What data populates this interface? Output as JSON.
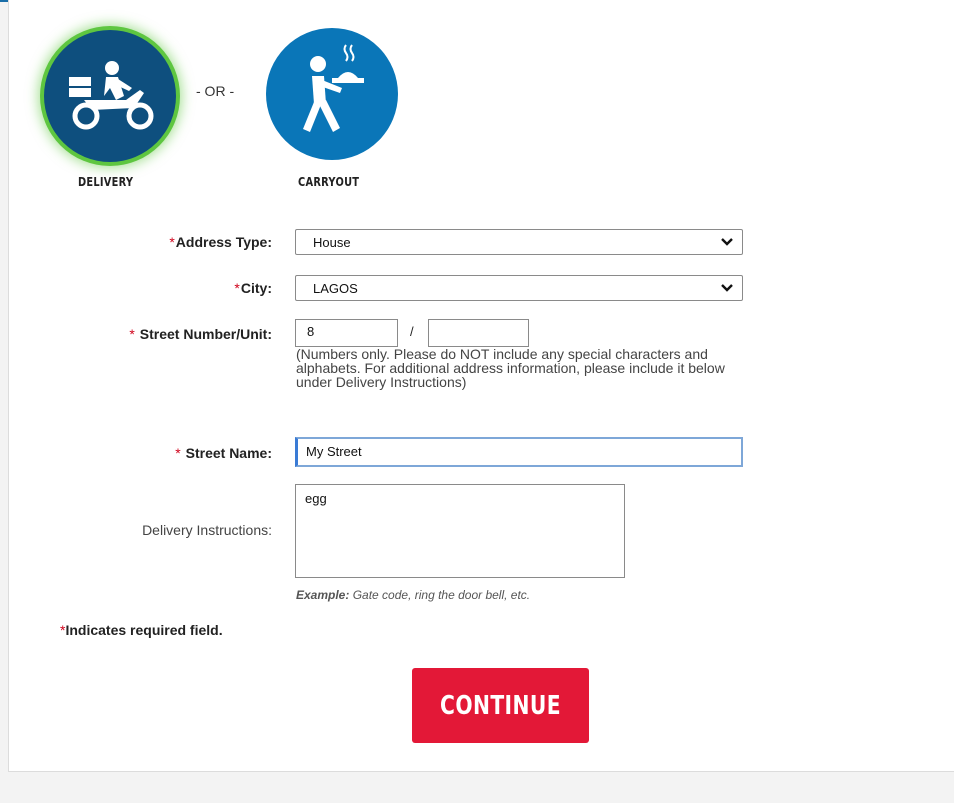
{
  "service_methods": {
    "separator": "- OR -",
    "delivery": {
      "label": "DELIVERY",
      "icon": "delivery-scooter-icon",
      "selected": true
    },
    "carryout": {
      "label": "CARRYOUT",
      "icon": "carryout-waiter-icon",
      "selected": false
    }
  },
  "form": {
    "required_marker": "*",
    "address_type": {
      "label": "Address Type:",
      "value": "House"
    },
    "city": {
      "label": "City:",
      "value": "LAGOS"
    },
    "street_number": {
      "label": "Street Number/Unit:",
      "number_value": "8",
      "unit_value": "",
      "separator": "/",
      "hint": "(Numbers only. Please do NOT include any special characters and alphabets. For additional address information, please include it below under Delivery Instructions)"
    },
    "street_name": {
      "label": "Street Name:",
      "value": "My Street"
    },
    "delivery_instructions": {
      "label": "Delivery Instructions:",
      "value": "egg",
      "example_prefix": "Example:",
      "example_text": "Gate code, ring the door bell, etc."
    },
    "required_note": "Indicates required field."
  },
  "actions": {
    "continue_label": "CONTINUE"
  },
  "colors": {
    "delivery_circle": "#0e4f7e",
    "carryout_circle": "#0a76b8",
    "selected_glow": "#5ec640",
    "continue_button": "#e31837",
    "required_marker": "#d0021b"
  }
}
